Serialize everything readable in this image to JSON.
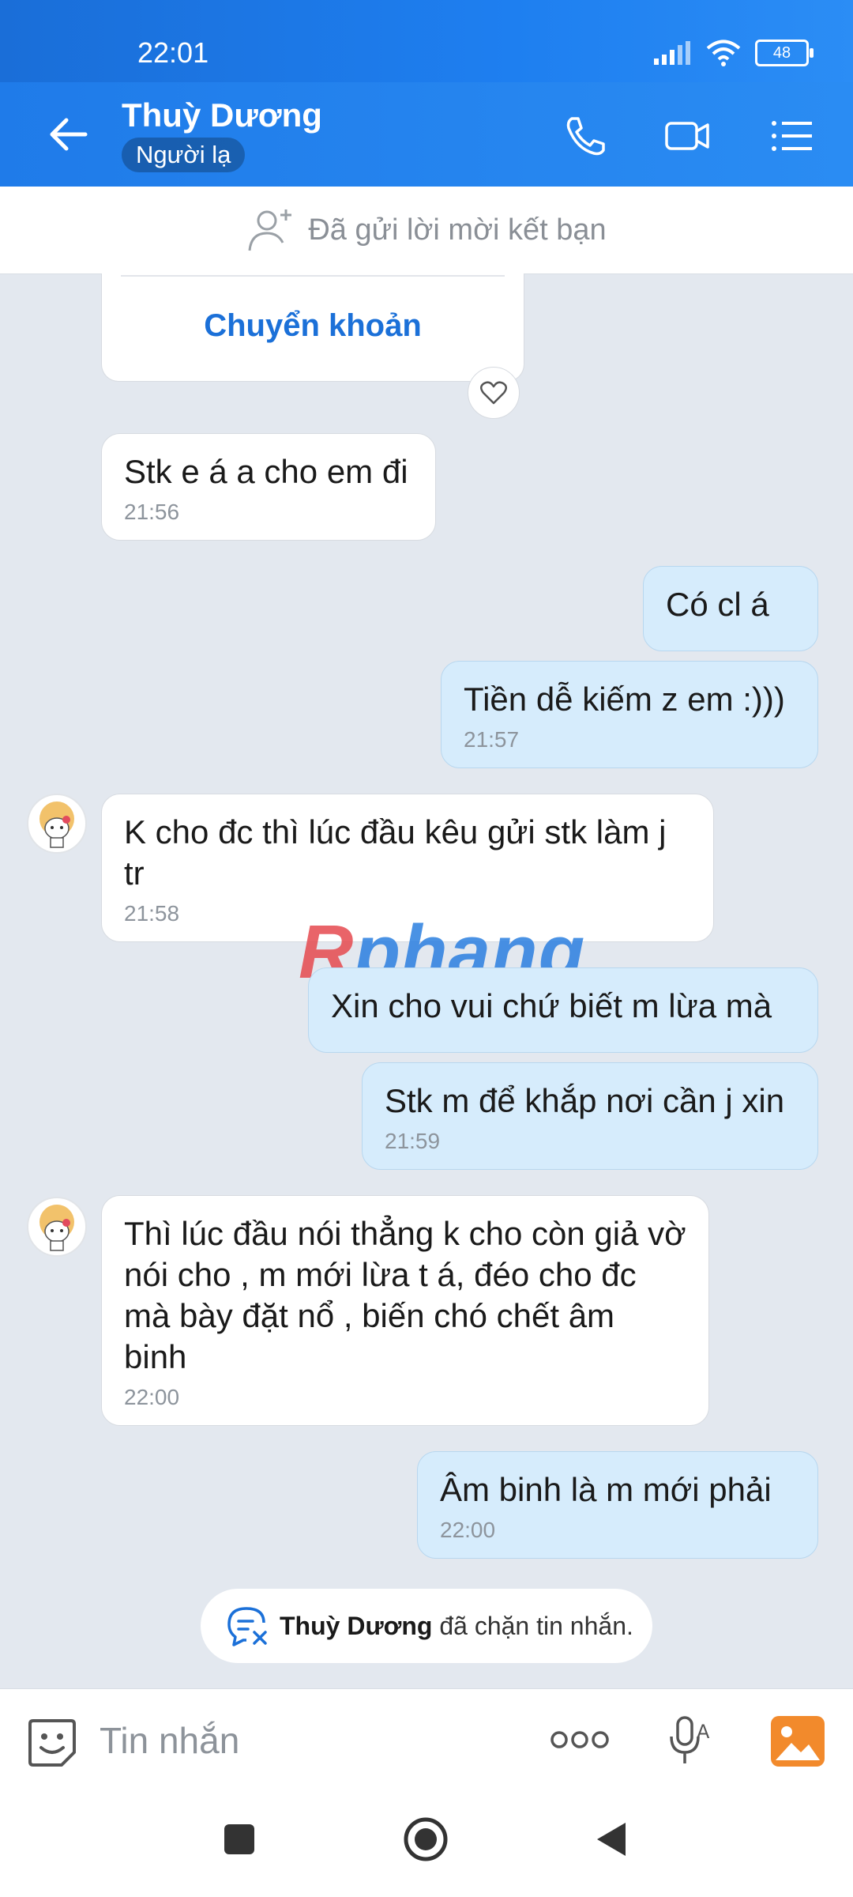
{
  "status_bar": {
    "time": "22:01",
    "battery": "48"
  },
  "header": {
    "contact_name": "Thuỳ Dương",
    "contact_tag": "Người lạ"
  },
  "friend_request": {
    "text": "Đã gửi lời mời kết bạn"
  },
  "transfer_card": {
    "button_label": "Chuyển khoản"
  },
  "messages": [
    {
      "dir": "in",
      "text": "Stk e á a cho em đi",
      "time": "21:56"
    },
    {
      "dir": "out",
      "text": "Có cl á",
      "time": ""
    },
    {
      "dir": "out",
      "text": "Tiền dễ kiếm z em :)))",
      "time": "21:57"
    },
    {
      "dir": "in",
      "text": "K cho đc thì lúc đầu kêu gửi stk làm j tr",
      "time": "21:58"
    },
    {
      "dir": "out",
      "text": "Xin cho vui chứ biết m lừa mà",
      "time": ""
    },
    {
      "dir": "out",
      "text": "Stk m để khắp nơi cần j xin",
      "time": "21:59"
    },
    {
      "dir": "in",
      "text": "Thì lúc đầu nói thẳng k cho còn giả vờ nói cho , m mới lừa t á, đéo cho đc mà bày đặt nổ , biến chó chết âm binh",
      "time": "22:00"
    },
    {
      "dir": "out",
      "text": "Âm binh là m mới phải",
      "time": "22:00"
    }
  ],
  "watermark": {
    "first": "R",
    "rest": "phang"
  },
  "blocked_notice": {
    "name": "Thuỳ Dương",
    "text": "đã chặn tin nhắn."
  },
  "composer": {
    "placeholder": "Tin nhắn"
  },
  "colors": {
    "header": "#1f7be9",
    "outgoing_bubble": "#d6ecfc",
    "incoming_bubble": "#ffffff",
    "chat_bg": "#e3e8ef",
    "link": "#1b70d8"
  }
}
